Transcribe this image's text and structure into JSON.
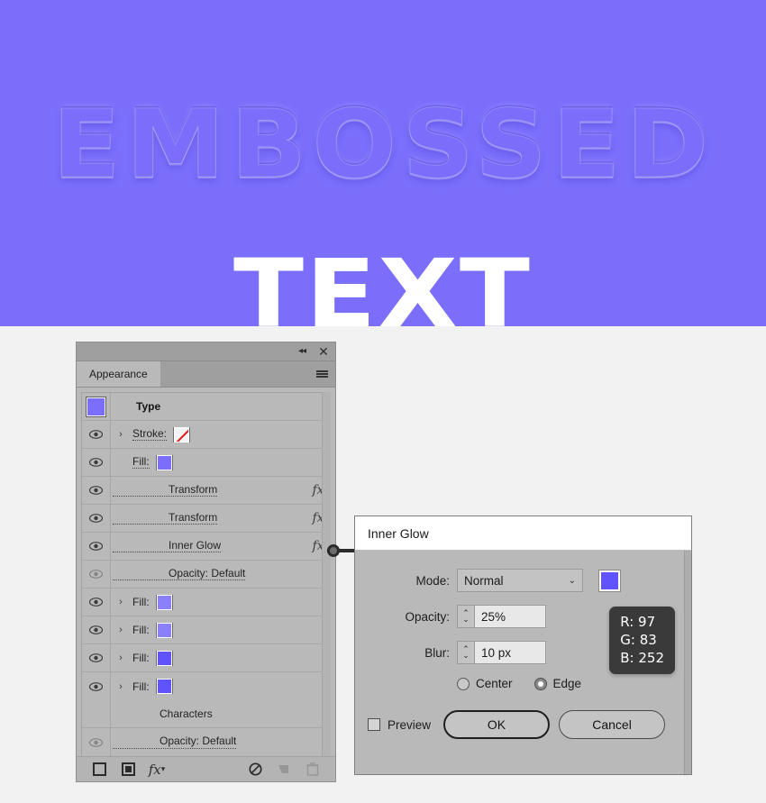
{
  "artboard": {
    "background_color": "#7a6efb",
    "emboss_word": "EMBOSSED",
    "solid_word": "TEXT",
    "solid_word_color": "#ffffff"
  },
  "panel": {
    "titlebar": {
      "collapse_icon": "collapse-double-left-icon",
      "collapse_glyph": "◂◂",
      "close_icon": "close-icon",
      "close_glyph": "✕"
    },
    "tab_label": "Appearance",
    "menu_icon": "hamburger-menu-icon",
    "type_row": {
      "label": "Type",
      "thumb_color": "#7a6efb"
    },
    "rows": [
      {
        "name": "stroke",
        "label": "Stroke:",
        "visible": true,
        "arrow": "›",
        "swatch": "none",
        "swatch_color": "",
        "fx": false,
        "dotted": true
      },
      {
        "name": "fill-main",
        "label": "Fill:",
        "visible": true,
        "arrow": "ⱟ",
        "swatch": "color",
        "swatch_color": "#7a6efb",
        "fx": false,
        "dotted": true
      },
      {
        "name": "transform-1",
        "label": "Transform",
        "visible": true,
        "arrow": "",
        "swatch": "",
        "swatch_color": "",
        "fx": true,
        "dotted": true,
        "indent": 1
      },
      {
        "name": "transform-2",
        "label": "Transform",
        "visible": true,
        "arrow": "",
        "swatch": "",
        "swatch_color": "",
        "fx": true,
        "dotted": true,
        "indent": 1
      },
      {
        "name": "inner-glow",
        "label": "Inner Glow",
        "visible": true,
        "arrow": "",
        "swatch": "",
        "swatch_color": "",
        "fx": true,
        "dotted": true,
        "indent": 1
      },
      {
        "name": "opacity-1",
        "label": "Opacity:  Default",
        "visible": false,
        "arrow": "",
        "swatch": "",
        "swatch_color": "",
        "fx": false,
        "dotted": true,
        "indent": 1
      },
      {
        "name": "fill-2",
        "label": "Fill:",
        "visible": true,
        "arrow": "›",
        "swatch": "color",
        "swatch_color": "#8b80fc",
        "fx": false,
        "dotted": false
      },
      {
        "name": "fill-3",
        "label": "Fill:",
        "visible": true,
        "arrow": "›",
        "swatch": "color",
        "swatch_color": "#8b80fc",
        "fx": false,
        "dotted": false
      },
      {
        "name": "fill-4",
        "label": "Fill:",
        "visible": true,
        "arrow": "›",
        "swatch": "color",
        "swatch_color": "#6153fc",
        "fx": false,
        "dotted": false
      },
      {
        "name": "fill-5",
        "label": "Fill:",
        "visible": true,
        "arrow": "›",
        "swatch": "color",
        "swatch_color": "#6153fc",
        "fx": false,
        "dotted": false
      }
    ],
    "characters_label": "Characters",
    "opacity_bottom_label": "Opacity:  Default",
    "footer_icons": [
      "new-stroke-icon",
      "new-fill-icon",
      "add-effect-fx-icon",
      "clear-appearance-icon",
      "duplicate-item-icon",
      "delete-item-icon"
    ]
  },
  "dialog": {
    "title": "Inner Glow",
    "mode_label": "Mode:",
    "mode_value": "Normal",
    "mode_chevron": "⌄",
    "glow_color": "#6153fc",
    "opacity_label": "Opacity:",
    "opacity_value": "25%",
    "blur_label": "Blur:",
    "blur_value": "10 px",
    "radio_center_label": "Center",
    "radio_edge_label": "Edge",
    "radio_selected": "Edge",
    "preview_label": "Preview",
    "preview_checked": false,
    "ok_label": "OK",
    "cancel_label": "Cancel",
    "rgb_tooltip": "R: 97\nG: 83\nB: 252",
    "rgb": {
      "r": "97",
      "g": "83",
      "b": "252"
    }
  }
}
